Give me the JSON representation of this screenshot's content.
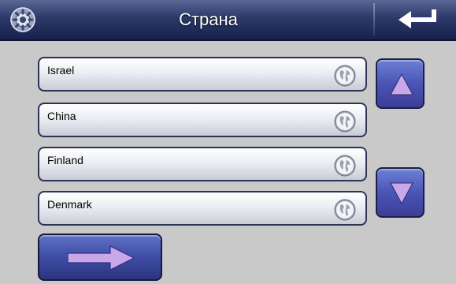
{
  "header": {
    "title": "Страна",
    "settings_icon": "gear-icon",
    "back_icon": "return-arrow-icon"
  },
  "countries": [
    {
      "label": "Israel",
      "icon": "globe-icon"
    },
    {
      "label": "China",
      "icon": "globe-icon"
    },
    {
      "label": "Finland",
      "icon": "globe-icon"
    },
    {
      "label": "Denmark",
      "icon": "globe-icon"
    }
  ],
  "controls": {
    "scroll_up_icon": "triangle-up-icon",
    "scroll_down_icon": "triangle-down-icon",
    "next_icon": "arrow-right-icon"
  },
  "colors": {
    "header_bg": "#1f2a57",
    "accent_button": "#4a55b5",
    "arrow_fill": "#c9a8ea"
  }
}
